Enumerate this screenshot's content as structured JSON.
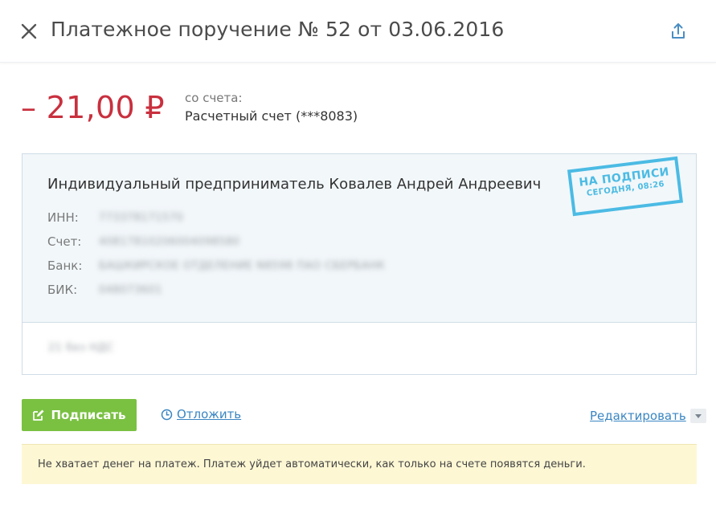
{
  "header": {
    "title": "Платежное поручение № 52 от 03.06.2016",
    "close_icon": "close-icon",
    "share_icon": "share-icon"
  },
  "payment": {
    "amount": "– 21,00 ₽",
    "from_label": "со счета:",
    "from_account": "Расчетный счет (***8083)"
  },
  "payee": {
    "name": "Индивидуальный предприниматель Ковалев Андрей Андреевич",
    "fields": [
      {
        "label": "ИНН:",
        "value": "773378171570"
      },
      {
        "label": "Счет:",
        "value": "40817810206004098580"
      },
      {
        "label": "Банк:",
        "value": "БАШКИРСКОЕ ОТДЕЛЕНИЕ N8598 ПАО СБЕРБАНК"
      },
      {
        "label": "БИК:",
        "value": "048073601"
      }
    ],
    "purpose": "21 без НДС"
  },
  "stamp": {
    "main": "НА ПОДПИСИ",
    "sub": "СЕГОДНЯ, 08:26"
  },
  "actions": {
    "sign_label": "Подписать",
    "postpone_label": "Отложить",
    "edit_label": "Редактировать"
  },
  "notice": {
    "text": "Не хватает денег на платеж. Платеж уйдет автоматически, как только на счете появятся деньги."
  },
  "colors": {
    "amount": "#c9303e",
    "sign_button": "#7ac142",
    "stamp": "#4bbbe4",
    "link": "#3a86c2",
    "notice_bg": "#fdf7d4"
  }
}
